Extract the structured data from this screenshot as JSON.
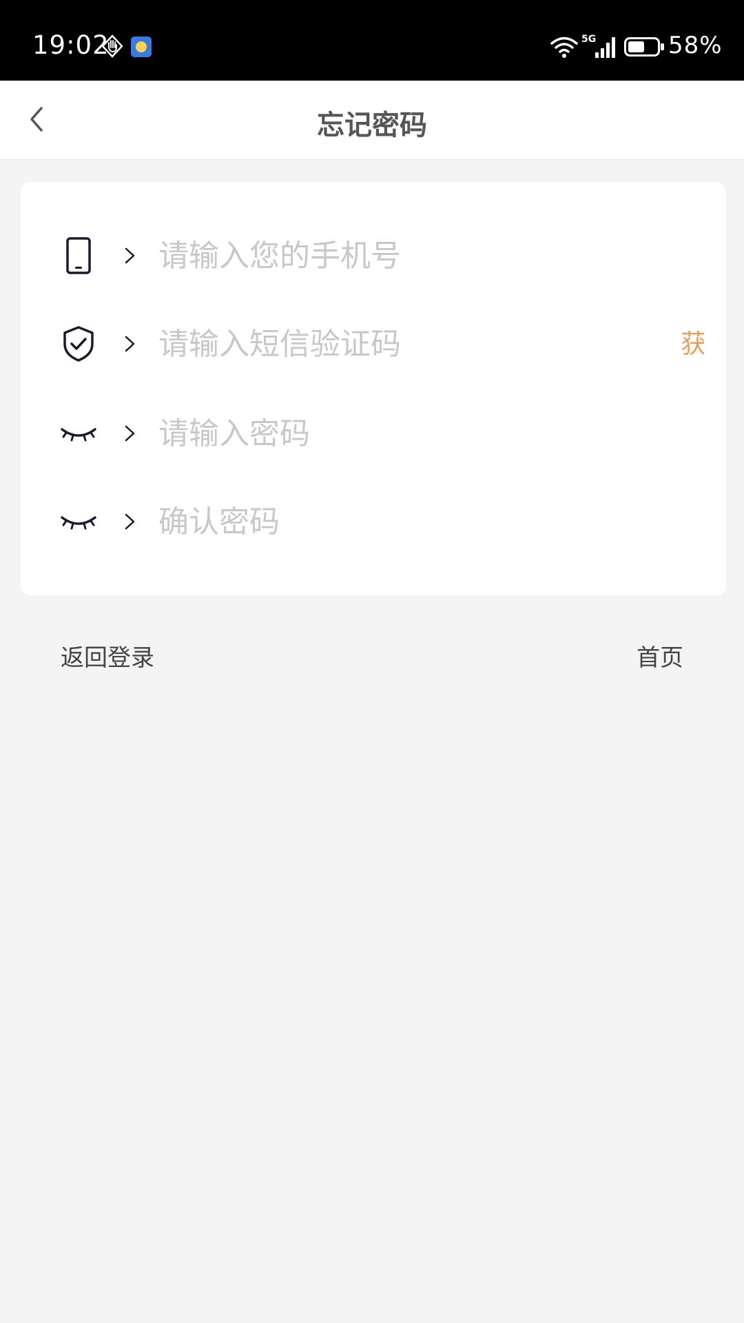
{
  "status_bar": {
    "time": "19:02",
    "network": "5G",
    "battery_percent": "58%",
    "battery_level": 0.58,
    "icons": [
      "hand-icon",
      "weather-icon",
      "wifi-icon",
      "cellular-signal-icon",
      "battery-icon"
    ]
  },
  "header": {
    "title": "忘记密码",
    "back_icon": "chevron-left-icon"
  },
  "form": {
    "phone": {
      "icon": "phone-icon",
      "placeholder": "请输入您的手机号",
      "value": ""
    },
    "sms_code": {
      "icon": "shield-check-icon",
      "placeholder": "请输入短信验证码",
      "value": "",
      "get_code_label": "获"
    },
    "password": {
      "icon": "eye-closed-icon",
      "placeholder": "请输入密码",
      "value": ""
    },
    "confirm_password": {
      "icon": "eye-closed-icon",
      "placeholder": "确认密码",
      "value": ""
    }
  },
  "footer": {
    "back_to_login": "返回登录",
    "home": "首页"
  },
  "colors": {
    "background": "#f4f4f4",
    "card": "#ffffff",
    "placeholder": "#c8c8c8",
    "accent": "#e8a060",
    "title": "#555555"
  }
}
